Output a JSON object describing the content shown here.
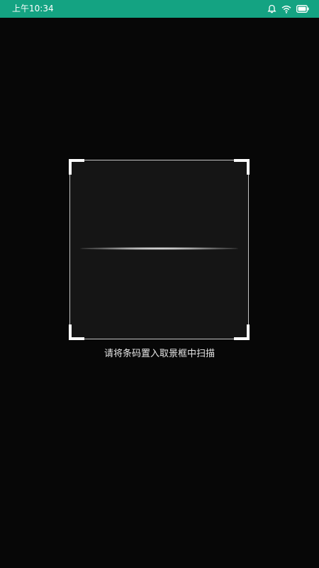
{
  "status_bar": {
    "time": "上午10:34",
    "color": "#14a382",
    "icons": [
      "bell-icon",
      "wifi-icon",
      "battery-icon"
    ]
  },
  "scanner": {
    "hint": "请将条码置入取景框中扫描",
    "background_color": "#070707"
  }
}
